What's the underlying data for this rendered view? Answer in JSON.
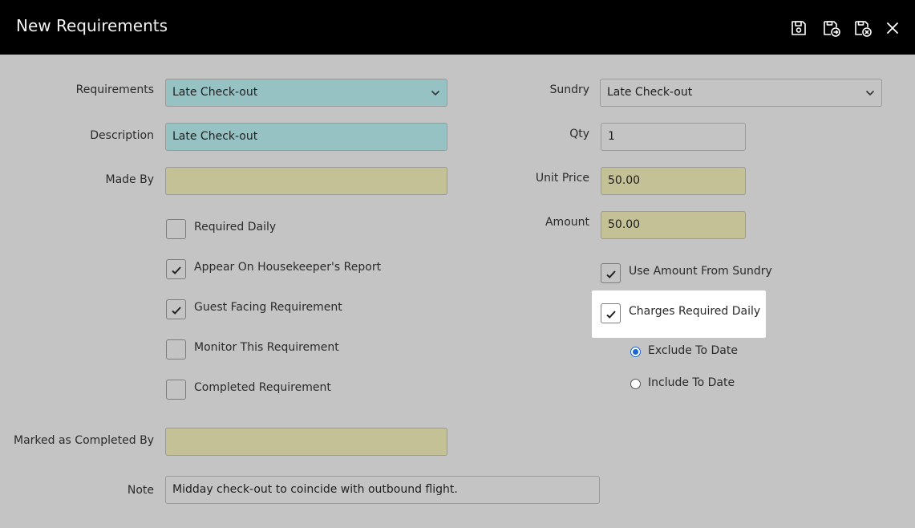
{
  "window": {
    "title": "New Requirements"
  },
  "toolbar": {
    "icons": [
      "save-icon",
      "save-and-continue-icon",
      "save-and-close-icon",
      "close-icon"
    ]
  },
  "left": {
    "requirements": {
      "label": "Requirements",
      "value": "Late Check-out"
    },
    "description": {
      "label": "Description",
      "value": "Late Check-out"
    },
    "made_by": {
      "label": "Made By",
      "value": ""
    },
    "checkboxes": [
      {
        "label": "Required Daily",
        "checked": false
      },
      {
        "label": "Appear On Housekeeper's Report",
        "checked": true
      },
      {
        "label": "Guest Facing Requirement",
        "checked": true
      },
      {
        "label": "Monitor This Requirement",
        "checked": false
      },
      {
        "label": "Completed Requirement",
        "checked": false
      }
    ],
    "marked_completed_by": {
      "label": "Marked as Completed By",
      "value": ""
    },
    "note": {
      "label": "Note",
      "value": "Midday check-out to coincide with outbound flight."
    }
  },
  "right": {
    "sundry": {
      "label": "Sundry",
      "value": "Late Check-out"
    },
    "qty": {
      "label": "Qty",
      "value": "1"
    },
    "unit_price": {
      "label": "Unit Price",
      "value": "50.00"
    },
    "amount": {
      "label": "Amount",
      "value": "50.00"
    },
    "use_amount_from_sundry": {
      "label": "Use Amount From Sundry",
      "checked": true
    },
    "charges_required_daily": {
      "label": "Charges Required Daily",
      "checked": true
    },
    "radios": [
      {
        "label": "Exclude To Date",
        "selected": true
      },
      {
        "label": "Include To Date",
        "selected": false
      }
    ]
  },
  "colors": {
    "titlebar": "#000000",
    "background": "#c4c4c4",
    "teal_field": "#97c2c4",
    "khaki_field": "#c4c197",
    "radio_accent": "#1a66d0"
  }
}
